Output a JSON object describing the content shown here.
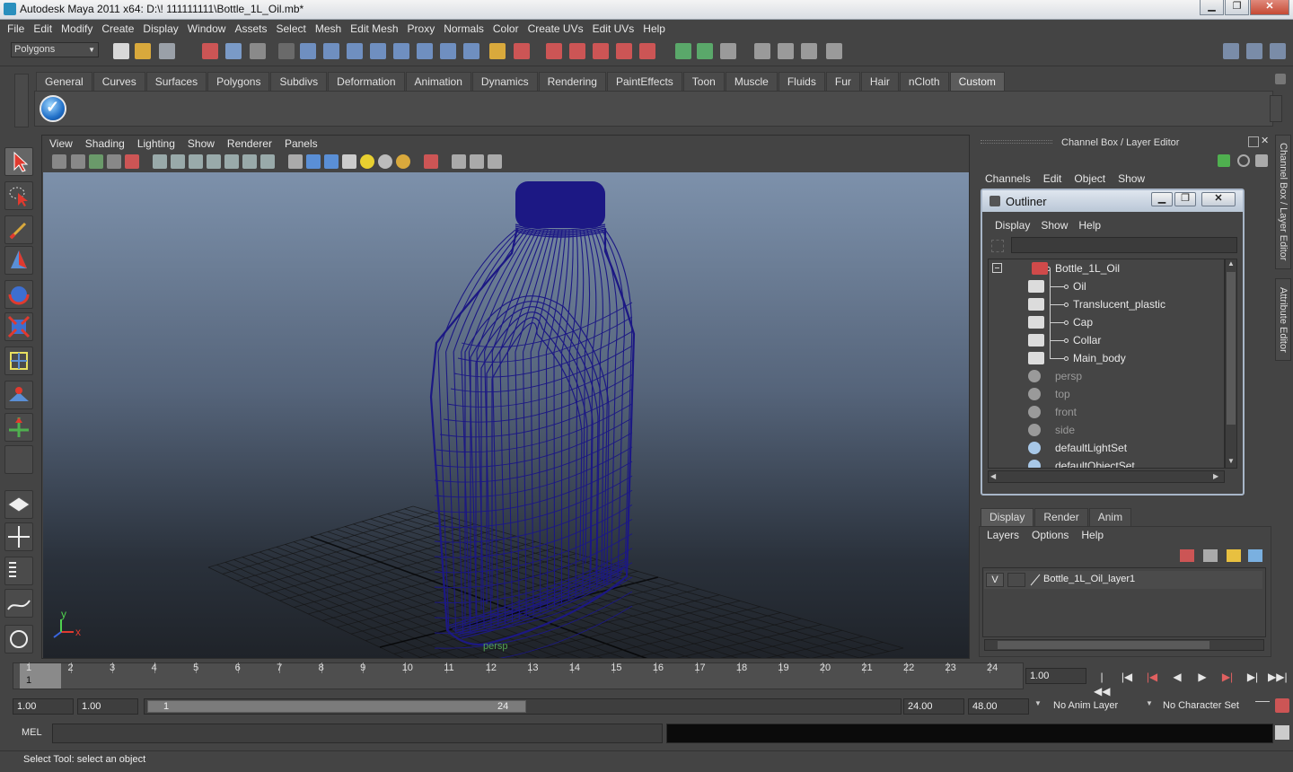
{
  "window": {
    "title": "Autodesk Maya 2011 x64: D:\\! 111111111\\Bottle_1L_Oil.mb*",
    "min": "▁",
    "max": "❐",
    "close": "✕"
  },
  "menubar": [
    "File",
    "Edit",
    "Modify",
    "Create",
    "Display",
    "Window",
    "Assets",
    "Select",
    "Mesh",
    "Edit Mesh",
    "Proxy",
    "Normals",
    "Color",
    "Create UVs",
    "Edit UVs",
    "Help"
  ],
  "statusline": {
    "mode": "Polygons"
  },
  "shelf": {
    "tabs": [
      "General",
      "Curves",
      "Surfaces",
      "Polygons",
      "Subdivs",
      "Deformation",
      "Animation",
      "Dynamics",
      "Rendering",
      "PaintEffects",
      "Toon",
      "Muscle",
      "Fluids",
      "Fur",
      "Hair",
      "nCloth",
      "Custom"
    ],
    "active_tab": "Custom"
  },
  "viewport": {
    "menu": [
      "View",
      "Shading",
      "Lighting",
      "Show",
      "Renderer",
      "Panels"
    ],
    "camera_label": "persp",
    "axis_x": "x",
    "axis_y": "y",
    "wire_color": "#1c1884",
    "grid_color": "#141414"
  },
  "channelbox": {
    "header": "Channel Box / Layer Editor",
    "menu": [
      "Channels",
      "Edit",
      "Object",
      "Show"
    ],
    "side_tabs": [
      "Channel Box / Layer Editor",
      "Attribute Editor"
    ]
  },
  "outliner": {
    "title": "Outliner",
    "menu": [
      "Display",
      "Show",
      "Help"
    ],
    "items": [
      {
        "label": "Bottle_1L_Oil",
        "kind": "group",
        "depth": 0,
        "dim": false
      },
      {
        "label": "Oil",
        "kind": "mesh",
        "depth": 1,
        "dim": false
      },
      {
        "label": "Translucent_plastic",
        "kind": "mesh",
        "depth": 1,
        "dim": false
      },
      {
        "label": "Cap",
        "kind": "mesh",
        "depth": 1,
        "dim": false
      },
      {
        "label": "Collar",
        "kind": "mesh",
        "depth": 1,
        "dim": false
      },
      {
        "label": "Main_body",
        "kind": "mesh",
        "depth": 1,
        "dim": false
      },
      {
        "label": "persp",
        "kind": "camera",
        "depth": 0,
        "dim": true
      },
      {
        "label": "top",
        "kind": "camera",
        "depth": 0,
        "dim": true
      },
      {
        "label": "front",
        "kind": "camera",
        "depth": 0,
        "dim": true
      },
      {
        "label": "side",
        "kind": "camera",
        "depth": 0,
        "dim": true
      },
      {
        "label": "defaultLightSet",
        "kind": "set",
        "depth": 0,
        "dim": false
      },
      {
        "label": "defaultObjectSet",
        "kind": "set",
        "depth": 0,
        "dim": false
      }
    ]
  },
  "layer_editor": {
    "tabs": [
      "Display",
      "Render",
      "Anim"
    ],
    "active_tab": "Display",
    "menu": [
      "Layers",
      "Options",
      "Help"
    ],
    "layer": {
      "visible": "V",
      "name": "Bottle_1L_Oil_layer1"
    }
  },
  "timeline": {
    "ticks": [
      "1",
      "2",
      "3",
      "4",
      "5",
      "6",
      "7",
      "8",
      "9",
      "10",
      "11",
      "12",
      "13",
      "14",
      "15",
      "16",
      "17",
      "18",
      "19",
      "20",
      "21",
      "22",
      "23",
      "24"
    ],
    "current_frame": "1",
    "current_time": "1.00",
    "playback_buttons": [
      "go-to-start",
      "step-back",
      "step-back-key",
      "play-backwards",
      "play-forwards",
      "step-forward-key",
      "step-forward",
      "go-to-end"
    ]
  },
  "range": {
    "start_time": "1.00",
    "start_playback": "1.00",
    "range_start": "1",
    "range_end": "24",
    "end_playback": "24.00",
    "end_time": "48.00",
    "anim_layer": "No Anim Layer",
    "character_set": "No Character Set"
  },
  "commandline": {
    "label": "MEL",
    "value": ""
  },
  "helpline": {
    "text": "Select Tool: select an object"
  }
}
